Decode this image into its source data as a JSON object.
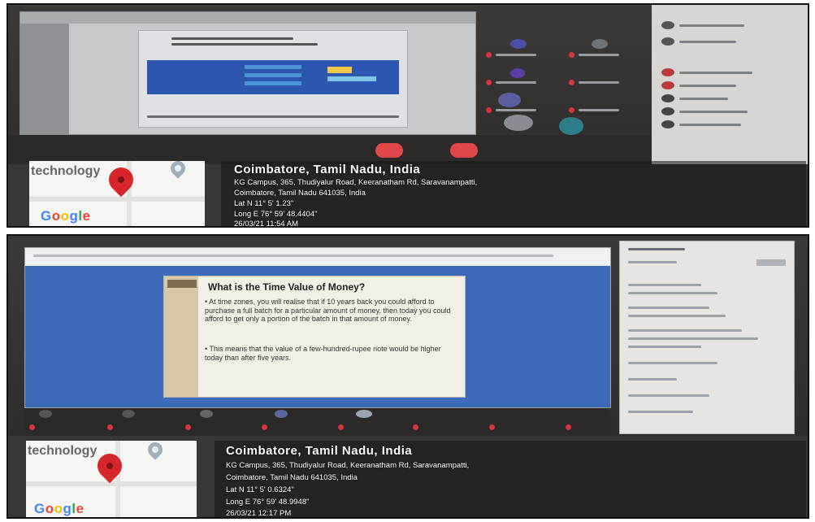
{
  "panel_top": {
    "geotag": {
      "map_label": "technology",
      "map_brand": "Google",
      "location_title": "Coimbatore, Tamil Nadu, India",
      "address_line1": "KG Campus, 365, Thudiyalur Road, Keeranatham Rd, Saravanampatti,",
      "address_line2": "Coimbatore, Tamil Nadu 641035, India",
      "lat": "Lat N 11° 5' 1.23\"",
      "long": "Long E 76° 59' 48.4404\"",
      "datetime": "26/03/21 11:54 AM"
    }
  },
  "panel_bottom": {
    "slide": {
      "title": "What is the Time Value of Money?",
      "bullets": [
        "At time zones, you will realise that if 10 years back you could afford to purchase a full batch for a particular amount of money, then today you could afford to get only a portion of the batch in that amount of money.",
        "This means that the value of a few-hundred-rupee note would be higher today than after five years."
      ]
    },
    "geotag": {
      "map_label": "technology",
      "map_brand": "Google",
      "location_title": "Coimbatore, Tamil Nadu, India",
      "address_line1": "KG Campus, 365, Thudiyalur Road, Keeranatham Rd, Saravanampatti,",
      "address_line2": "Coimbatore, Tamil Nadu 641035, India",
      "lat": "Lat N 11° 5' 0.6324\"",
      "long": "Long E 76° 59' 48.9948\"",
      "datetime": "26/03/21 12:17 PM"
    }
  },
  "colors": {
    "slide_blue": "#2c57b0",
    "pin_red": "#d7262b",
    "zoom_red": "#e0454a",
    "google_blue": "#4285f4",
    "google_red": "#ea4335",
    "google_yellow": "#fbbc05",
    "google_green": "#34a853"
  },
  "icons": [
    "map-pin-icon",
    "location-marker-icon",
    "end-meeting-icon"
  ]
}
